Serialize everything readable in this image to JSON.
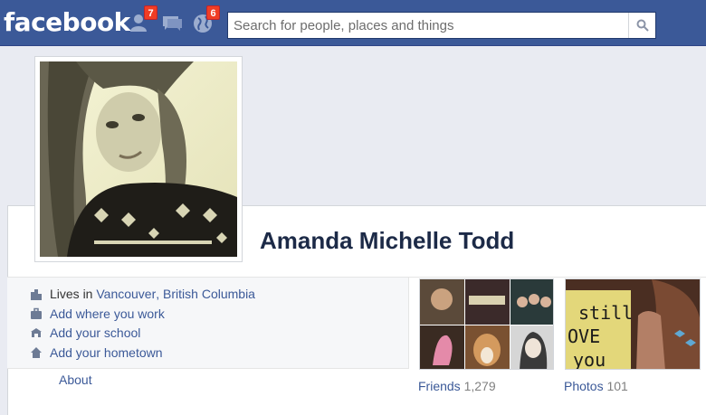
{
  "header": {
    "logo_text": "facebook",
    "friend_requests_badge": "7",
    "notifications_badge": "6",
    "search_placeholder": "Search for people, places and things",
    "icons": [
      "friends-icon",
      "messages-icon",
      "globe-icon",
      "search-icon"
    ]
  },
  "profile": {
    "name": "Amanda Michelle Todd"
  },
  "info": {
    "lives_prefix": "Lives in ",
    "city": "Vancouver",
    "comma": ", ",
    "province": "British Columbia",
    "work": "Add where you work",
    "school": "Add your school",
    "hometown": "Add your hometown",
    "about": "About"
  },
  "tiles": {
    "friends_label": "Friends",
    "friends_count": "1,279",
    "photos_label": "Photos",
    "photos_count": "101",
    "photo_caption_line1": "still",
    "photo_caption_line2": "OVE",
    "photo_caption_line3": "you"
  },
  "colors": {
    "brand": "#3b5998",
    "badge": "#f03d25",
    "background": "#e9ebf2",
    "name_text": "#1c2a47"
  }
}
